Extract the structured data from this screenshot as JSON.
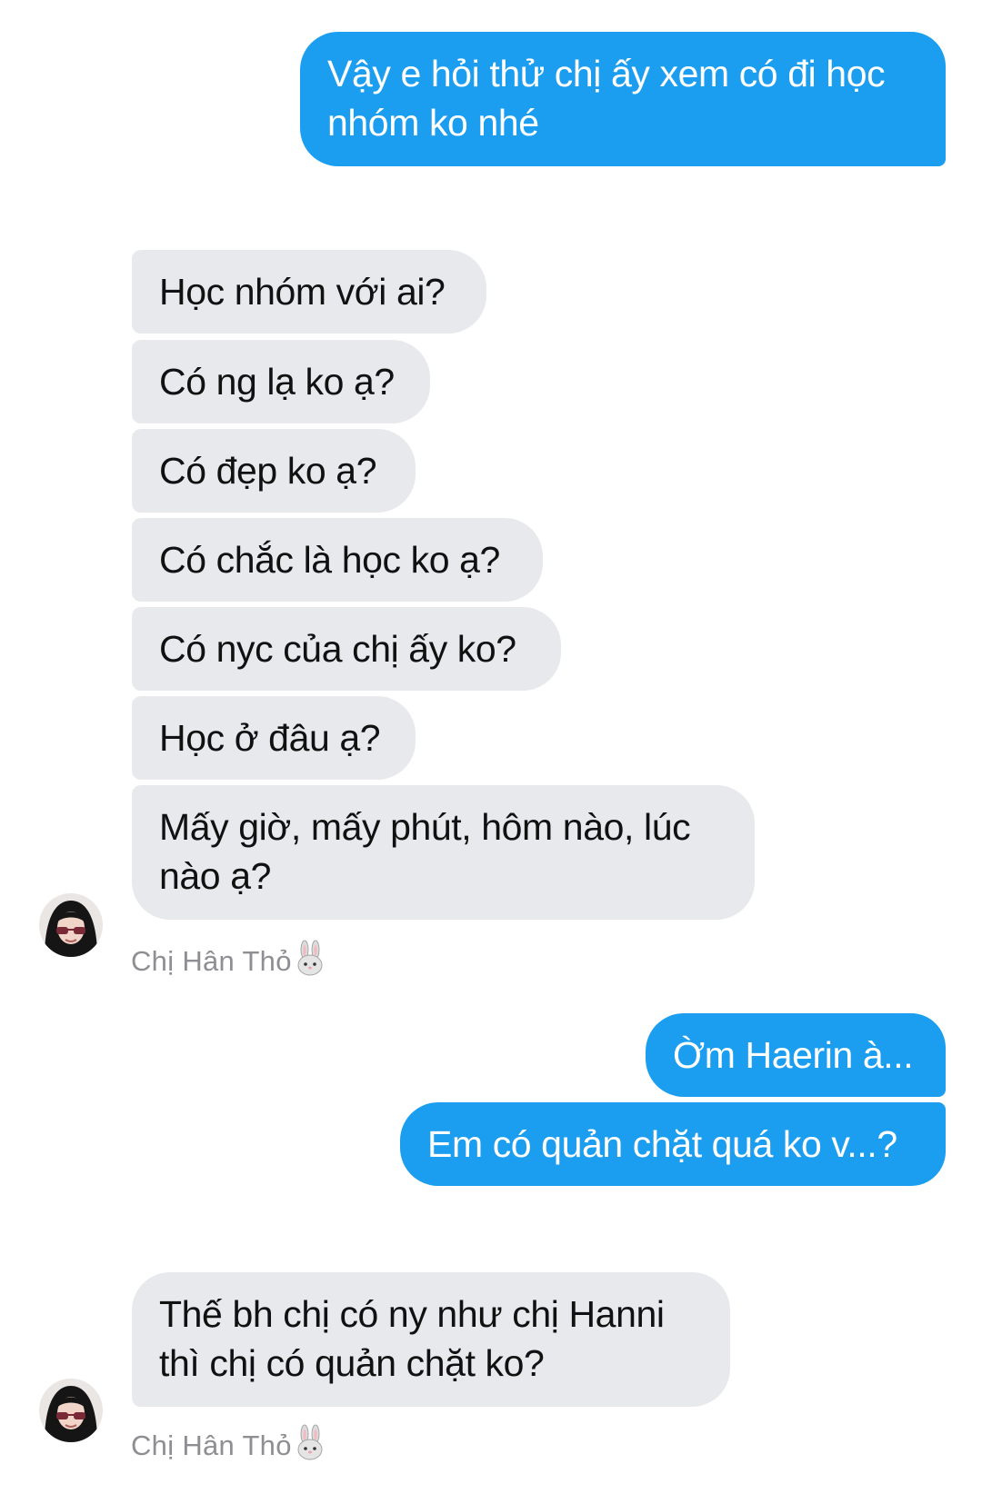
{
  "colors": {
    "outgoing_bubble": "#1c9ef0",
    "incoming_bubble": "#e8e9ed",
    "sender_label": "#8e8e93"
  },
  "conversation": {
    "group1_outgoing": [
      "Vậy e hỏi thử chị ấy xem có đi học nhóm ko nhé"
    ],
    "group2_incoming": [
      "Học nhóm với ai?",
      "Có ng lạ ko ạ?",
      "Có đẹp ko ạ?",
      "Có chắc là học ko ạ?",
      "Có nyc của chị ấy ko?",
      "Học ở đâu ạ?",
      "Mấy giờ, mấy phút, hôm nào, lúc nào ạ?"
    ],
    "group2_sender": "Chị Hân Thỏ",
    "group3_outgoing": [
      "Ờm Haerin à...",
      "Em có quản chặt quá ko v...?"
    ],
    "group4_incoming": [
      "Thế bh chị có ny như chị Hanni thì chị có quản chặt ko?"
    ],
    "group4_sender": "Chị Hân Thỏ",
    "sender_emoji_icon": "rabbit-face-icon",
    "avatar_icon": "profile-photo-girl-sunglasses"
  }
}
